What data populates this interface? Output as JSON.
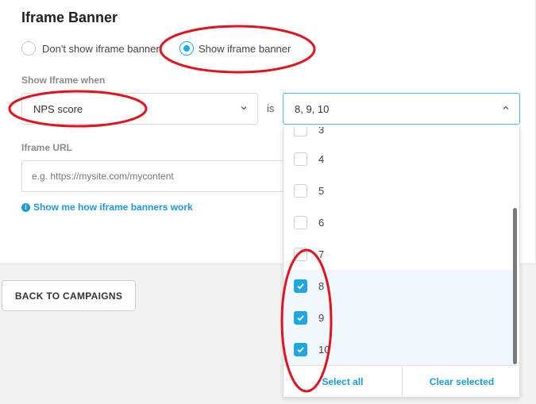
{
  "section": {
    "title": "Iframe Banner"
  },
  "radios": {
    "dont_show": "Don't show iframe banner",
    "show": "Show iframe banner",
    "selected": "show"
  },
  "show_when": {
    "label": "Show Iframe when",
    "field": "NPS score",
    "operator": "is",
    "value": "8, 9, 10"
  },
  "iframe_url": {
    "label": "Iframe URL",
    "placeholder": "e.g. https://mysite.com/mycontent",
    "value": ""
  },
  "help_link": "Show me how iframe banners work",
  "back_button": "BACK TO CAMPAIGNS",
  "dropdown": {
    "options": [
      {
        "label": "3",
        "checked": false
      },
      {
        "label": "4",
        "checked": false
      },
      {
        "label": "5",
        "checked": false
      },
      {
        "label": "6",
        "checked": false
      },
      {
        "label": "7",
        "checked": false
      },
      {
        "label": "8",
        "checked": true
      },
      {
        "label": "9",
        "checked": true
      },
      {
        "label": "10",
        "checked": true
      }
    ],
    "select_all": "Select all",
    "clear_selected": "Clear selected"
  },
  "colors": {
    "accent": "#1ea7e0",
    "link": "#1a9bd7",
    "annotation": "#e0141e"
  },
  "icons": {
    "info": "info-icon",
    "chevron_down": "chevron-down-icon",
    "chevron_up": "chevron-up-icon",
    "check": "check-icon"
  }
}
